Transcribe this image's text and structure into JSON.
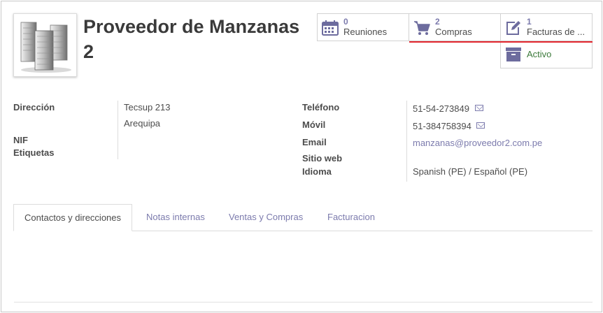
{
  "partner": {
    "title": "Proveedor de Manzanas 2",
    "avatar_icon": "building-icon"
  },
  "smart_buttons": [
    {
      "count": "0",
      "label": "Reuniones",
      "icon": "calendar-icon"
    },
    {
      "count": "2",
      "label": "Compras",
      "icon": "cart-icon"
    },
    {
      "count": "1",
      "label": "Facturas de ...",
      "icon": "edit-icon"
    },
    {
      "label": "Activo",
      "icon": "archive-icon"
    }
  ],
  "left_fields": {
    "address_label": "Dirección",
    "street": "Tecsup 213",
    "city": "Arequipa",
    "vat_label": "NIF",
    "tags_label": "Etiquetas"
  },
  "right_fields": {
    "phone_label": "Teléfono",
    "phone": "51-54-273849",
    "mobile_label": "Móvil",
    "mobile": "51-384758394",
    "email_label": "Email",
    "email": "manzanas@proveedor2.com.pe",
    "website_label": "Sitio web",
    "lang_label": "Idioma",
    "lang": "Spanish (PE) / Español (PE)"
  },
  "tabs": [
    {
      "label": "Contactos y direcciones",
      "active": true
    },
    {
      "label": "Notas internas",
      "active": false
    },
    {
      "label": "Ventas y Compras",
      "active": false
    },
    {
      "label": "Facturacion",
      "active": false
    }
  ],
  "colors": {
    "accent": "#7c7bad",
    "active_status": "#3c7a3b",
    "highlight": "#e3262e"
  }
}
